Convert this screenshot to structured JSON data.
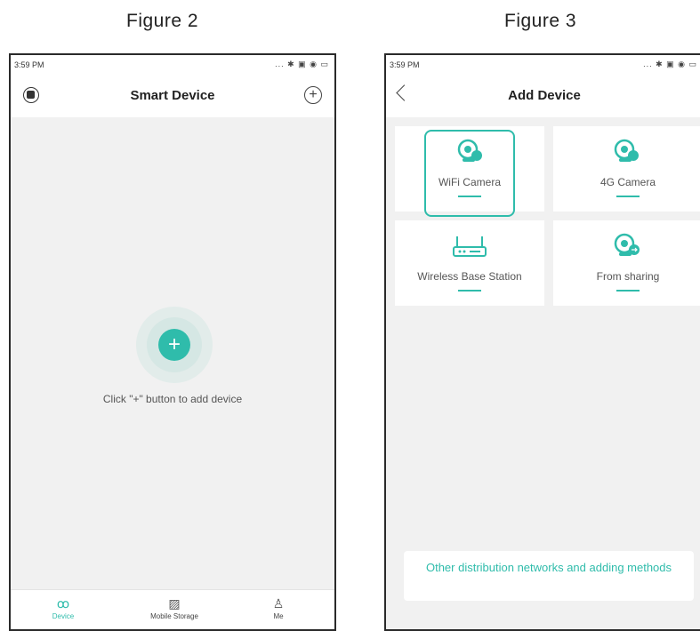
{
  "figure2": {
    "caption": "Figure 2",
    "status": {
      "time": "3:59 PM",
      "icons": "... ✱ ▣ ◉ ▭"
    },
    "nav": {
      "title": "Smart Device"
    },
    "empty_hint": "Click \"+\" button to add device",
    "add_button_glyph": "+",
    "plus_icon_glyph": "+",
    "tabs": [
      {
        "label": "Device",
        "icon": "device-icon",
        "glyph": "ꝏ"
      },
      {
        "label": "Mobile Storage",
        "icon": "picture-icon",
        "glyph": "▨"
      },
      {
        "label": "Me",
        "icon": "person-icon",
        "glyph": "♙"
      }
    ]
  },
  "figure3": {
    "caption": "Figure 3",
    "status": {
      "time": "3:59 PM",
      "icons": "... ✱ ▣ ◉ ▭"
    },
    "nav": {
      "title": "Add Device"
    },
    "cards": [
      {
        "label": "WiFi Camera",
        "icon": "wifi-camera-icon",
        "selected": true
      },
      {
        "label": "4G Camera",
        "icon": "4g-camera-icon",
        "selected": false
      },
      {
        "label": "Wireless Base Station",
        "icon": "router-icon",
        "selected": false
      },
      {
        "label": "From sharing",
        "icon": "share-camera-icon",
        "selected": false
      }
    ],
    "other_methods": "Other distribution networks and adding methods"
  },
  "colors": {
    "accent": "#2fbcab",
    "background": "#f1f1f1"
  }
}
